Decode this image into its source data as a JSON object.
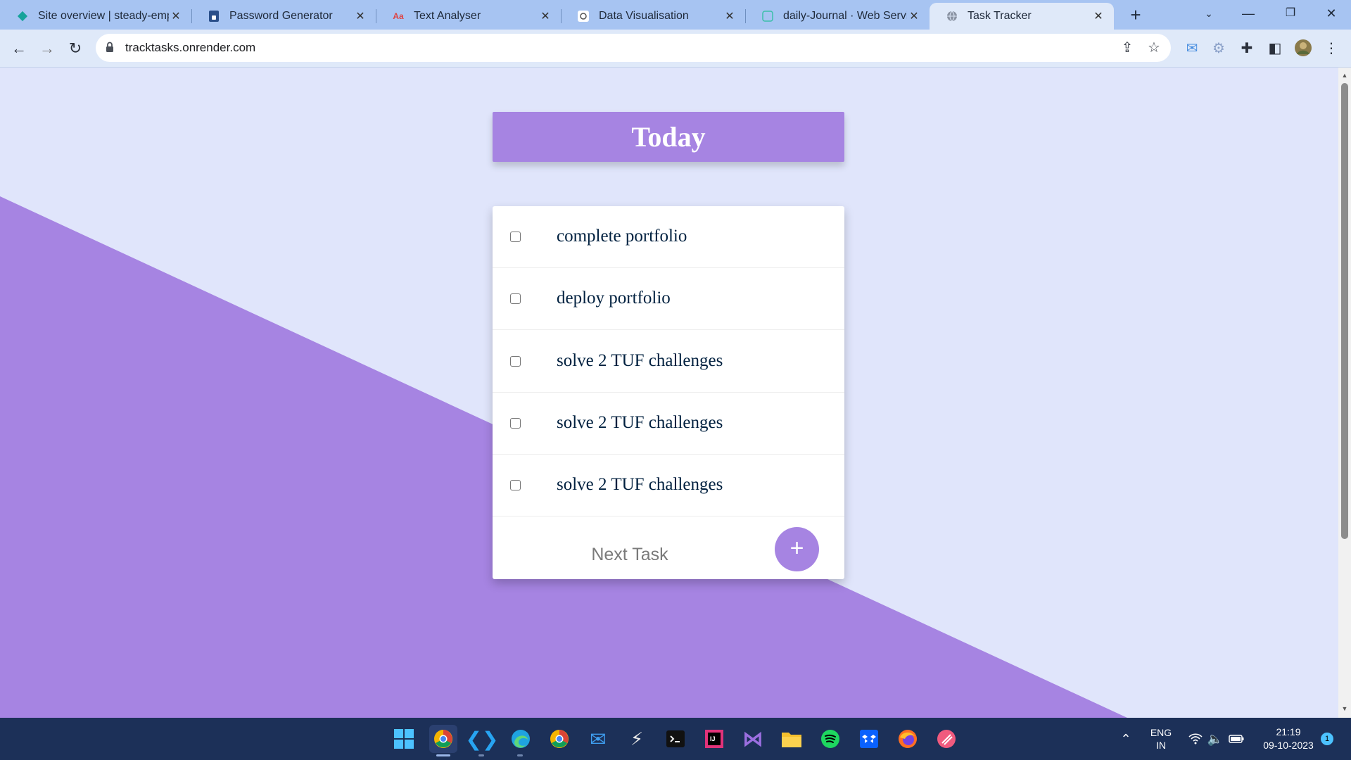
{
  "browser": {
    "tabs": [
      {
        "title": "Site overview | steady-emp",
        "icon": "netlify-icon",
        "active": false
      },
      {
        "title": "Password Generator",
        "icon": "lock-icon",
        "active": false
      },
      {
        "title": "Text Analyser",
        "icon": "text-analyser-icon",
        "active": false
      },
      {
        "title": "Data Visualisation",
        "icon": "data-vis-icon",
        "active": false
      },
      {
        "title": "daily-Journal · Web Servic",
        "icon": "render-icon",
        "active": false
      },
      {
        "title": "Task Tracker",
        "icon": "globe-icon",
        "active": true
      }
    ],
    "url": "tracktasks.onrender.com"
  },
  "page": {
    "heading": "Today",
    "tasks": [
      {
        "label": "complete portfolio",
        "done": false
      },
      {
        "label": "deploy portfolio",
        "done": false
      },
      {
        "label": "solve 2 TUF challenges",
        "done": false
      },
      {
        "label": "solve 2 TUF challenges",
        "done": false
      },
      {
        "label": "solve 2 TUF challenges",
        "done": false
      }
    ],
    "new_task_placeholder": "Next Task",
    "add_button_label": "+"
  },
  "colors": {
    "page_bg": "#e0e5fb",
    "accent": "#a684e2",
    "task_text": "#00203f",
    "tabstrip": "#a7c4f2",
    "taskbar": "#1c3058"
  },
  "taskbar": {
    "apps": [
      "windows-start-icon",
      "chrome-canary-icon",
      "vscode-icon",
      "edge-icon",
      "chrome-icon",
      "mail-icon",
      "git-icon",
      "terminal-icon",
      "intellij-icon",
      "visual-studio-icon",
      "file-explorer-icon",
      "spotify-icon",
      "dropbox-icon",
      "firefox-icon",
      "app-icon"
    ],
    "language": "ENG",
    "region": "IN",
    "time": "21:19",
    "date": "09-10-2023",
    "notification_count": "1"
  }
}
